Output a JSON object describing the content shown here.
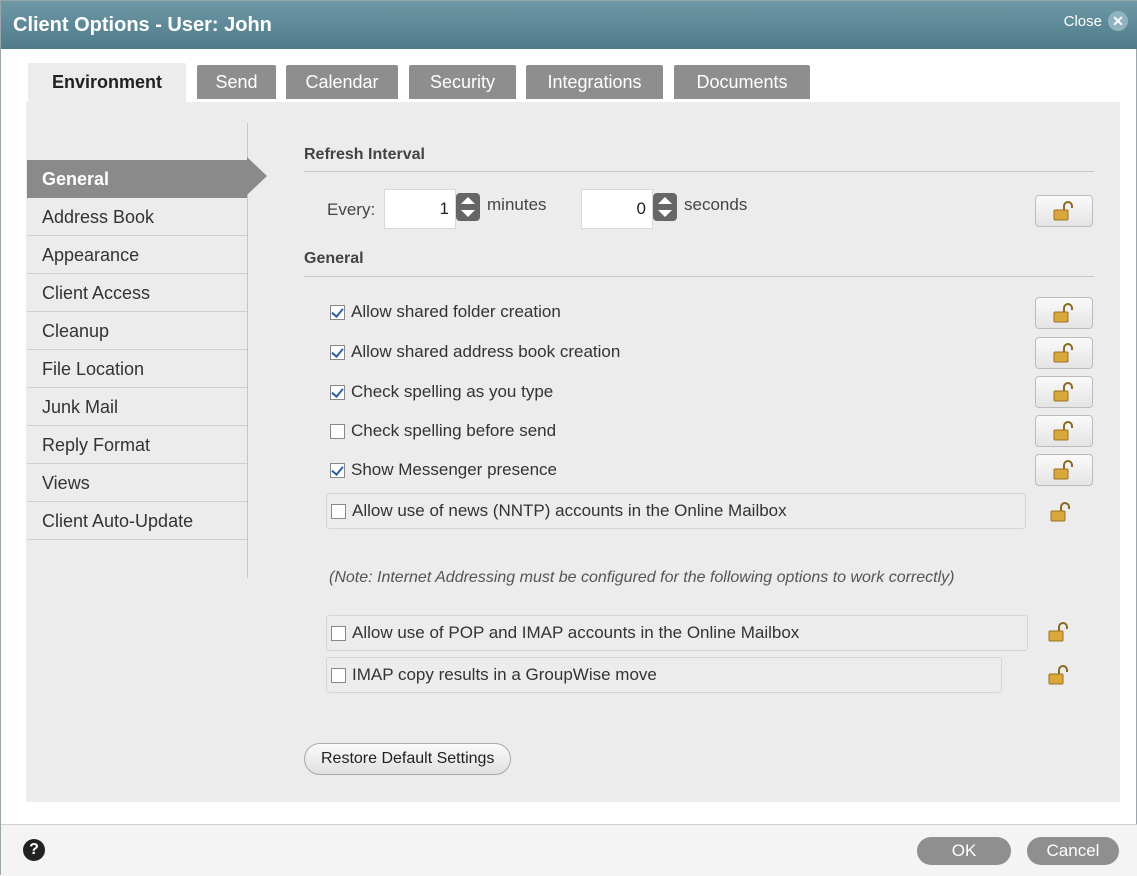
{
  "window": {
    "title": "Client Options - User: John",
    "close_label": "Close",
    "close_glyph": "✕"
  },
  "tabs": [
    {
      "label": "Environment",
      "active": true
    },
    {
      "label": "Send"
    },
    {
      "label": "Calendar"
    },
    {
      "label": "Security"
    },
    {
      "label": "Integrations"
    },
    {
      "label": "Documents"
    }
  ],
  "sidebar": {
    "items": [
      {
        "label": "General",
        "active": true
      },
      {
        "label": "Address Book"
      },
      {
        "label": "Appearance"
      },
      {
        "label": "Client Access"
      },
      {
        "label": "Cleanup"
      },
      {
        "label": "File Location"
      },
      {
        "label": "Junk Mail"
      },
      {
        "label": "Reply Format"
      },
      {
        "label": "Views"
      },
      {
        "label": "Client Auto-Update"
      }
    ]
  },
  "refresh": {
    "heading": "Refresh Interval",
    "every_label": "Every:",
    "minutes_value": "1",
    "minutes_label": "minutes",
    "seconds_value": "0",
    "seconds_label": "seconds"
  },
  "general": {
    "heading": "General",
    "options": [
      {
        "label": "Allow shared folder creation",
        "checked": true
      },
      {
        "label": "Allow shared address book creation",
        "checked": true
      },
      {
        "label": "Check spelling as you type",
        "checked": true
      },
      {
        "label": "Check spelling before send",
        "checked": false
      },
      {
        "label": "Show Messenger presence",
        "checked": true
      },
      {
        "label": "Allow use of news (NNTP) accounts in the Online Mailbox",
        "checked": false
      }
    ],
    "note": "(Note: Internet Addressing must be configured for the following options to work correctly)",
    "internet_options": [
      {
        "label": "Allow use of POP and IMAP accounts in the Online Mailbox",
        "checked": false
      },
      {
        "label": "IMAP copy results in a GroupWise move",
        "checked": false
      }
    ]
  },
  "restore_label": "Restore Default Settings",
  "footer": {
    "help_glyph": "?",
    "ok_label": "OK",
    "cancel_label": "Cancel"
  },
  "icons": {
    "lock": "lock-open-icon",
    "help": "help-icon",
    "close": "close-icon"
  }
}
